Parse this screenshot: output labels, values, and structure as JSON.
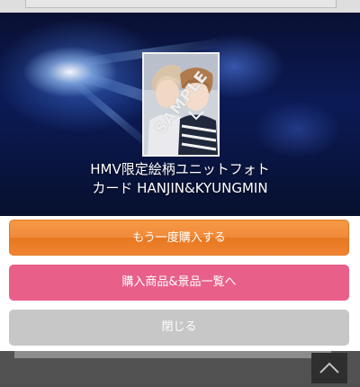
{
  "modal": {
    "card_title": "HMV限定絵柄ユニットフォトカード HANJIN&KYUNGMIN",
    "watermark": "SAMPLE"
  },
  "buttons": {
    "buy_again": "もう一度購入する",
    "purchase_list": "購入商品&景品一覧へ",
    "close": "閉じる"
  },
  "icons": {
    "back_to_top": "chevron-up-icon"
  },
  "colors": {
    "buy_again": "#f08a36",
    "purchase_list": "#e8608a",
    "close": "#c7c7c7",
    "hero_bg": "#0b1a55"
  }
}
